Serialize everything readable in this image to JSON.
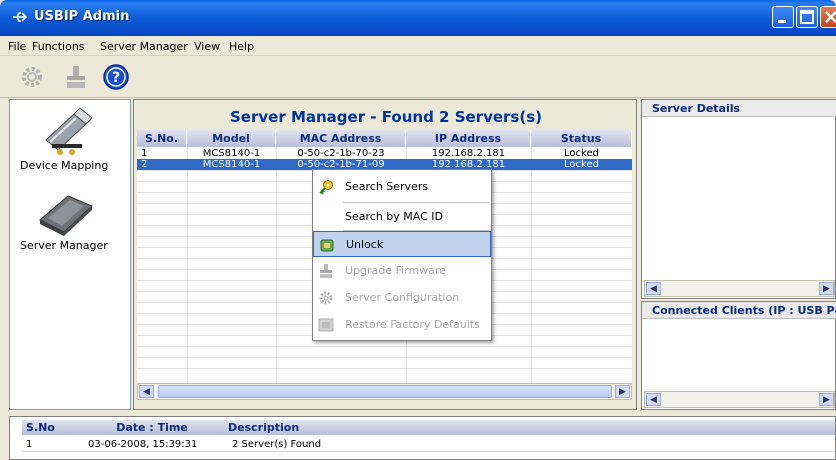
{
  "window": {
    "title": "USBIP Admin",
    "controls": [
      "minimize",
      "maximize",
      "close"
    ]
  },
  "menubar": {
    "items": [
      "File",
      "Functions",
      "Server Manager",
      "View",
      "Help"
    ]
  },
  "toolbar": {
    "buttons": [
      {
        "icon": "gear-icon",
        "enabled": false
      },
      {
        "icon": "firmware-icon",
        "enabled": false
      },
      {
        "icon": "help-icon",
        "glyph": "?",
        "enabled": true
      }
    ]
  },
  "sidebar": {
    "items": [
      {
        "label": "Device Mapping",
        "icon": "usb-device-icon"
      },
      {
        "label": "Server Manager",
        "icon": "server-device-icon"
      }
    ]
  },
  "main": {
    "title": "Server Manager - Found 2 Servers(s)",
    "columns": [
      "S.No.",
      "Model",
      "MAC Address",
      "IP Address",
      "Status"
    ],
    "rows": [
      {
        "sno": "1",
        "model": "MCS8140-1",
        "mac": "0-50-c2-1b-70-23",
        "ip": "192.168.2.181",
        "status": "Locked",
        "selected": false
      },
      {
        "sno": "2",
        "model": "MCS8140-1",
        "mac": "0-50-c2-1b-71-09",
        "ip": "192.168.2.181",
        "status": "Locked",
        "selected": true
      }
    ]
  },
  "context_menu": {
    "items": [
      {
        "label": "Search Servers",
        "icon": "key-icon",
        "enabled": true
      },
      {
        "label": "Search by MAC ID",
        "icon": "",
        "enabled": true
      },
      {
        "label": "Unlock",
        "icon": "unlock-icon",
        "enabled": true,
        "highlighted": true
      },
      {
        "label": "Upgrade Firmware",
        "icon": "firmware-icon",
        "enabled": false
      },
      {
        "label": "Server Configuration",
        "icon": "gear-icon",
        "enabled": false
      },
      {
        "label": "Restore Factory Defaults",
        "icon": "restore-icon",
        "enabled": false
      }
    ]
  },
  "details": {
    "server_details_title": "Server Details",
    "clients_title": "Connected Clients (IP : USB Port)"
  },
  "log": {
    "columns": [
      "S.No",
      "Date : Time",
      "Description"
    ],
    "rows": [
      {
        "sno": "1",
        "datetime": "03-06-2008, 15:39:31",
        "description": "2 Server(s) Found"
      }
    ]
  },
  "colors": {
    "title_bar": "#0a5ad4",
    "selection": "#3169c6",
    "header_text": "#0a2a7a",
    "main_title": "#0033a0"
  }
}
